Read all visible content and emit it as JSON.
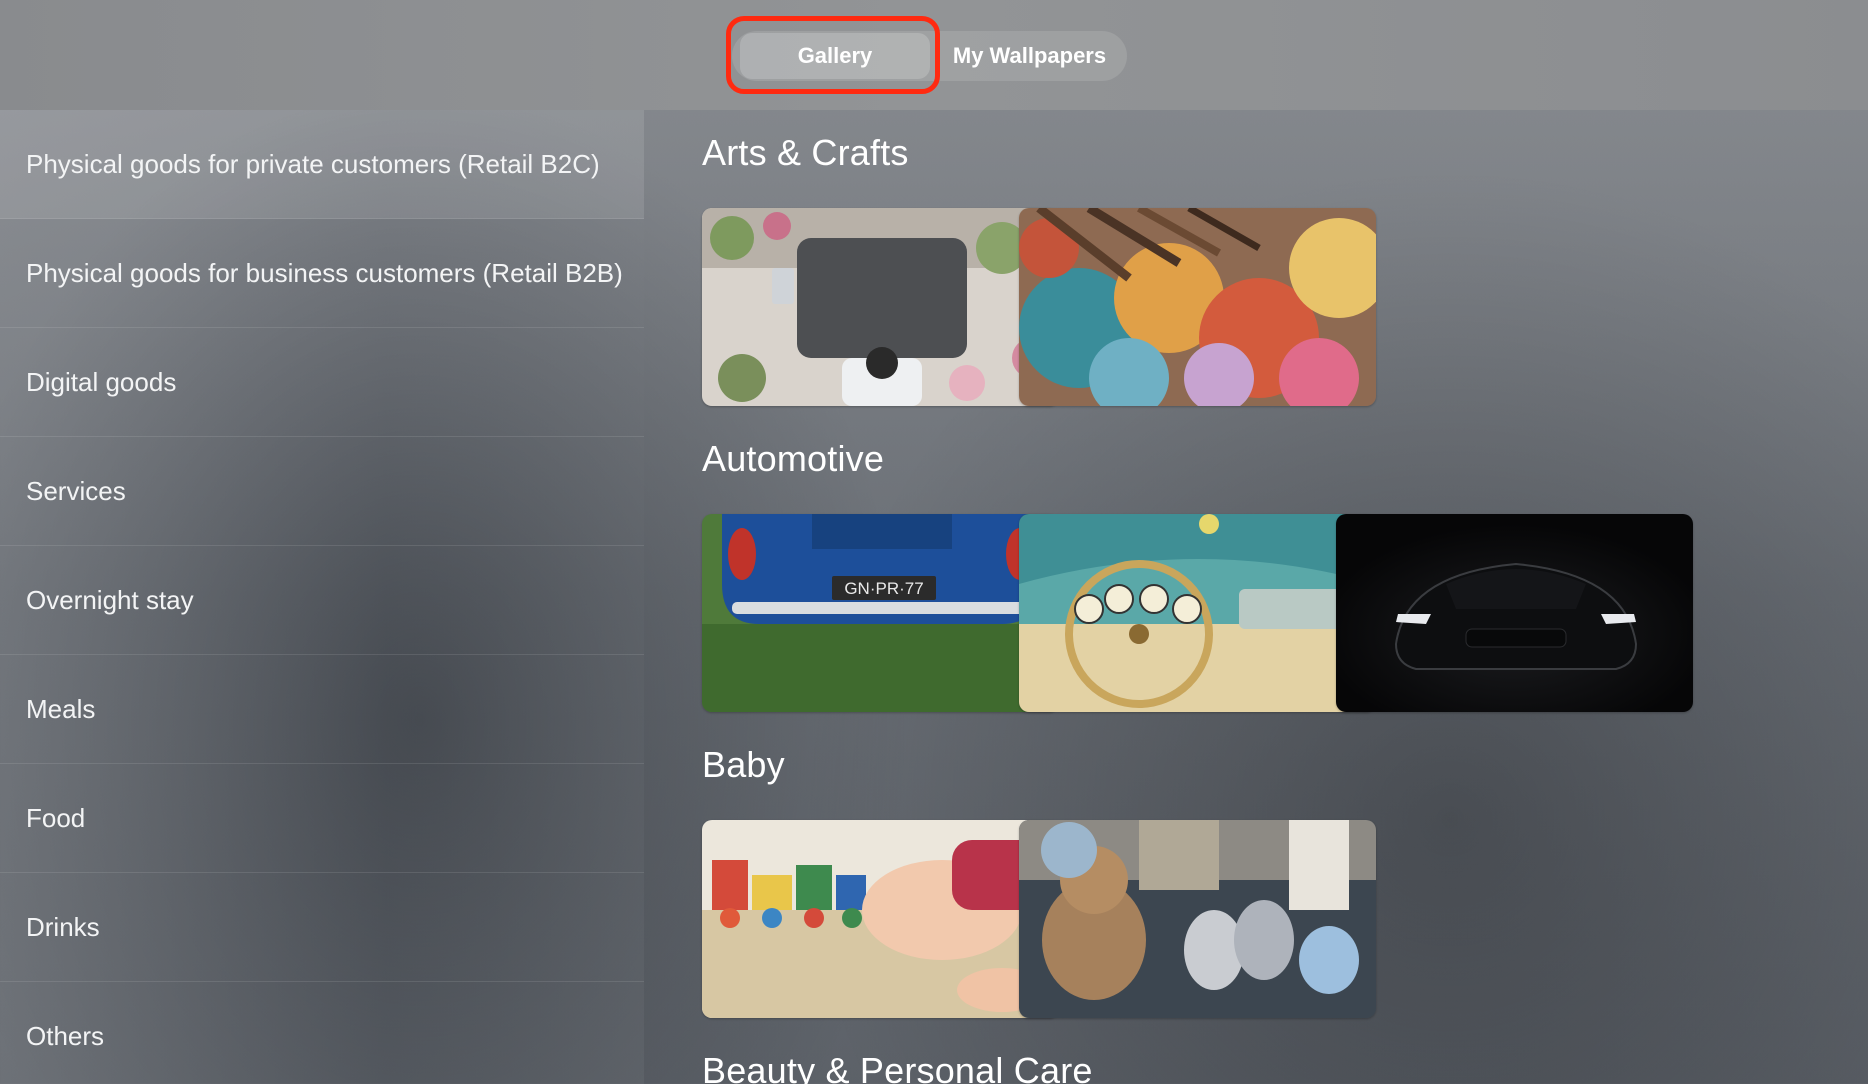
{
  "tabs": {
    "gallery": "Gallery",
    "my_wallpapers": "My Wallpapers"
  },
  "sidebar": {
    "items": [
      {
        "label": "Physical goods for private customers (Retail B2C)"
      },
      {
        "label": "Physical goods for business customers (Retail B2B)"
      },
      {
        "label": "Digital goods"
      },
      {
        "label": "Services"
      },
      {
        "label": "Overnight stay"
      },
      {
        "label": "Meals"
      },
      {
        "label": "Food"
      },
      {
        "label": "Drinks"
      },
      {
        "label": "Others"
      }
    ]
  },
  "main": {
    "sections": [
      {
        "title": "Arts & Crafts",
        "images": [
          "flower-shop-paper-image",
          "paint-palette-brushes-image"
        ]
      },
      {
        "title": "Automotive",
        "images": [
          "blue-vintage-car-rear-image",
          "classic-car-dashboard-image",
          "black-sports-car-image"
        ],
        "plate_text": "GN·PR·77"
      },
      {
        "title": "Baby",
        "images": [
          "toddler-toy-train-image",
          "teddy-bear-baby-shoes-image"
        ]
      },
      {
        "title": "Beauty & Personal Care",
        "images": []
      }
    ]
  },
  "colors": {
    "highlight": "#ff2a10",
    "text": "#ffffff"
  }
}
